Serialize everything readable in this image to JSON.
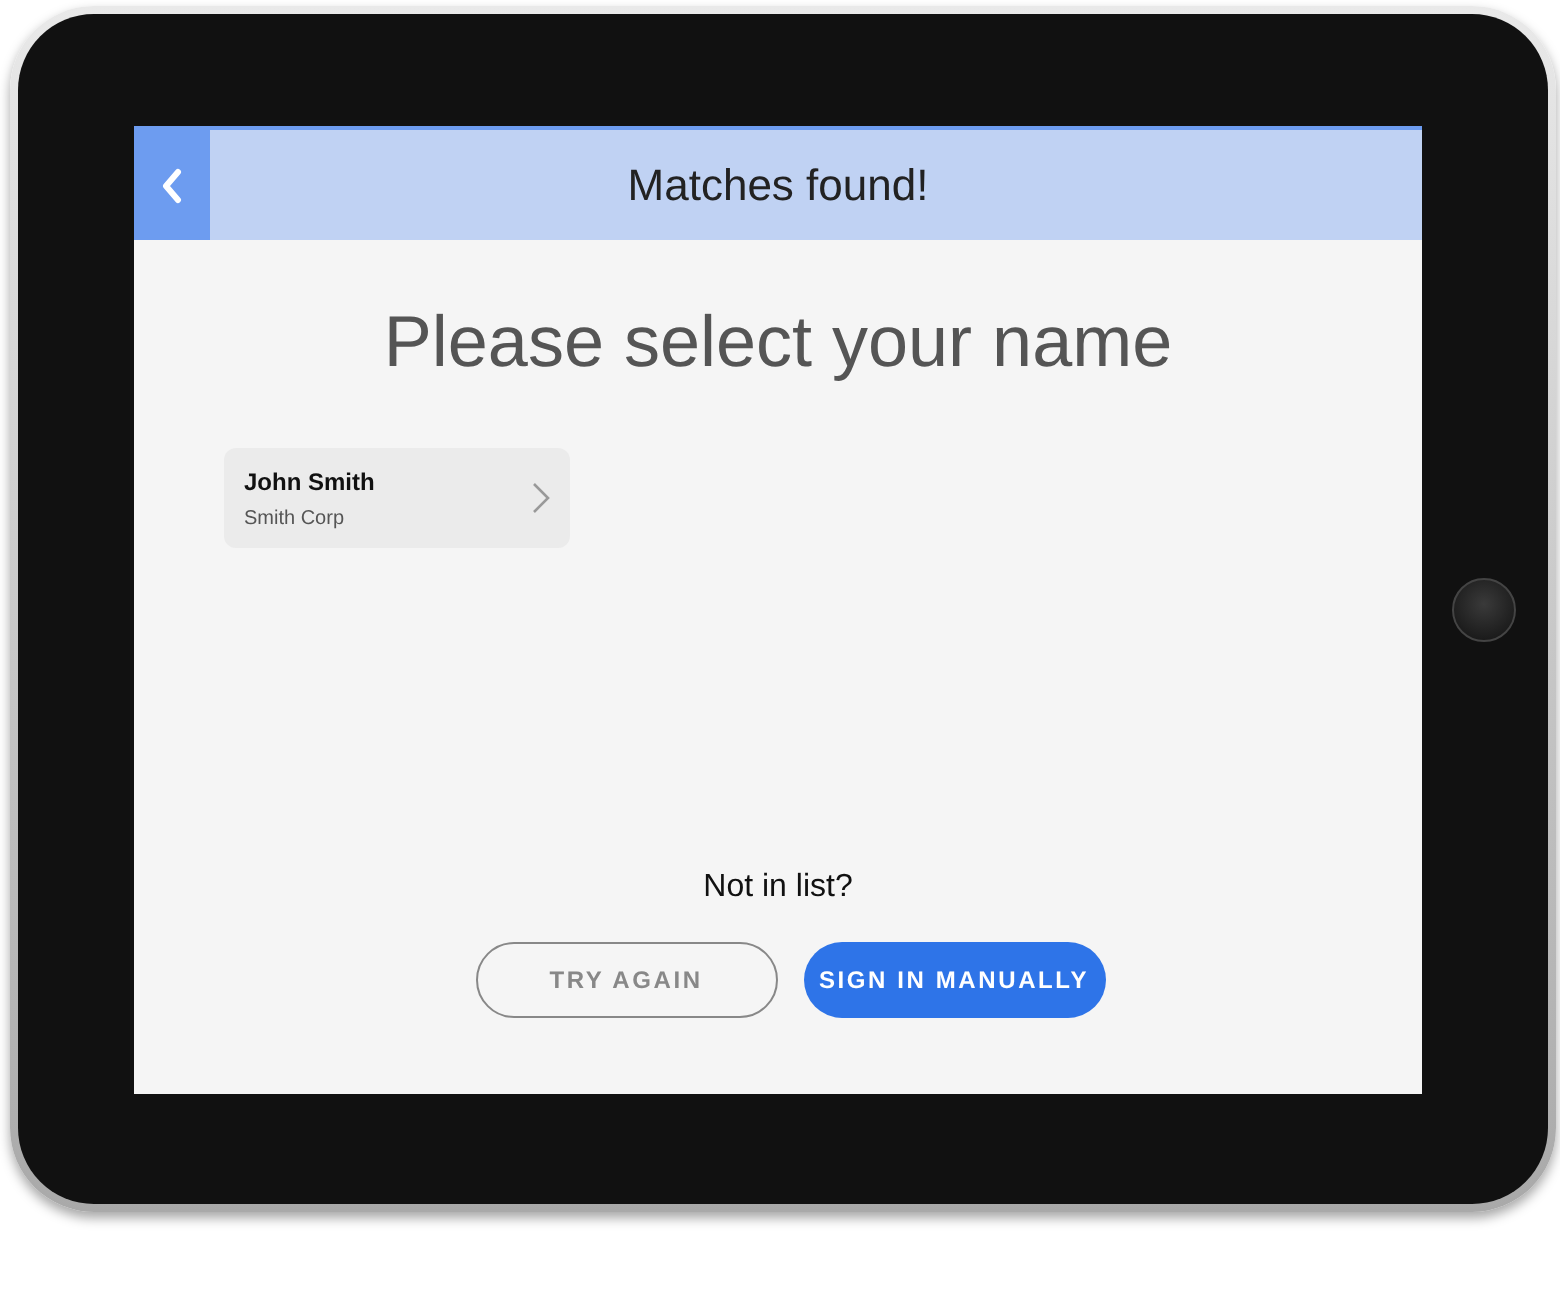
{
  "header": {
    "title": "Matches found!"
  },
  "heading": "Please select your name",
  "matches": [
    {
      "name": "John Smith",
      "company": "Smith Corp"
    }
  ],
  "prompt": "Not in list?",
  "buttons": [
    {
      "label": "TRY AGAIN",
      "kind": "outline"
    },
    {
      "label": "SIGN IN MANUALLY",
      "kind": "filled"
    }
  ]
}
